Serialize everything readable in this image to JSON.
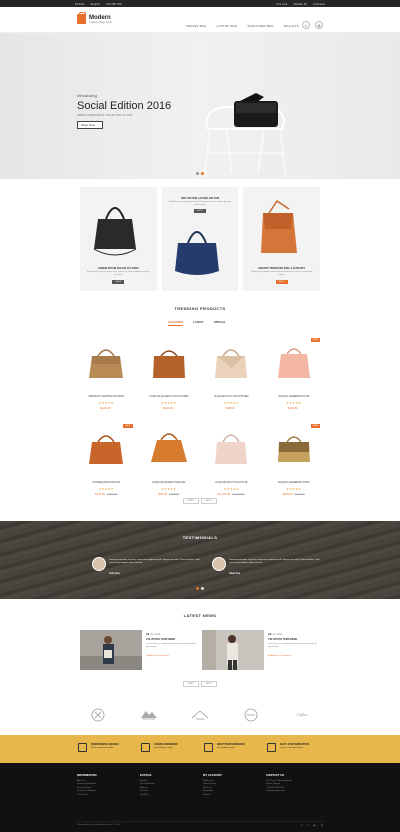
{
  "topbar": {
    "currency": "$ Dollar",
    "language": "English",
    "phone": "123 456 789",
    "account": "Your Link",
    "wishlist": "Wishlist (0)",
    "checkout": "Checkout"
  },
  "header": {
    "logo_title": "Modern",
    "logo_sub": "Creative Bags Shop",
    "nav": [
      "TRAVEL BAG",
      "LAPTOP BAG",
      "SHOULDER BAG",
      "WALLETS"
    ],
    "accent": "#e8702a"
  },
  "hero": {
    "intro": "Introducing",
    "title": "Social Edition 2016",
    "subtitle": "SIMPLE URBAN BAGS COLLECTION OF 2016",
    "button": "Shop Now"
  },
  "banners": [
    {
      "title": "LOREM IPSUM DOLOR SIT AMET",
      "desc": "Nunc efficitur, ultricies ipsum risus, finibus est, tortor vestibulum nisl mi, nec nunc.",
      "button": "SHOP"
    },
    {
      "title": "SED DICTUM LACINIA DICTUM",
      "desc": "Vestibulum ante ipsum primis in faucibus orci luctus et ultrices posuere cubilia curae.",
      "button": "SHOP"
    },
    {
      "title": "MAURIS TINCIDUNT NISL A SUSCIPIT",
      "desc": "Pellentesque habitant morbi tristique senectus et netus et malesuada fames.",
      "button": "SHOP"
    }
  ],
  "trending": {
    "title": "TRENDING PRODUCTS",
    "tabs": [
      "FEATURED",
      "LATEST",
      "SPECIAL"
    ],
    "pager": [
      "PREV",
      "NEXT"
    ]
  },
  "products": [
    {
      "name": "ABSTRACT LEATHER SATCHEL",
      "stars": "★★★★★",
      "price": "$146.00",
      "old": ""
    },
    {
      "name": "ALIQUAM QUAERAT VOLUPTATEM",
      "stars": "★★★★★",
      "price": "$122.00",
      "old": ""
    },
    {
      "name": "ALIQUAM QUAT VOLUPTATEM",
      "stars": "★★★★★",
      "price": "$98.00",
      "old": ""
    },
    {
      "name": "ALIQUET LEABERIAN FUSE",
      "stars": "★★★★★",
      "price": "$122.00",
      "old": "",
      "sale": "SALE"
    },
    {
      "name": "CONSEQUATUR DOLOR",
      "stars": "★★★★★",
      "price": "$134.00",
      "old": "$172.00",
      "sale": "SALE"
    },
    {
      "name": "ALIQUAM QUAERAT MOLLER",
      "stars": "★★★★★",
      "price": "$90.00",
      "old": "$128.00"
    },
    {
      "name": "ALIQUAM QUAT VOLUPTATE",
      "stars": "★★★★★",
      "price": "$1,122.00",
      "old": "$1,140.00"
    },
    {
      "name": "ALIQUET LEABERIAN VORO",
      "stars": "★★★★★",
      "price": "$110.00",
      "old": "$122.00",
      "sale": "SALE"
    }
  ],
  "testimonials": {
    "title": "TESTIMONIALS",
    "items": [
      {
        "text": "Lorem ipsum dolor sit amet, consectetur adipiscing elit. Integer nec odio. Praesent libero. Sed cursus ante dapibus diam sed nisi.",
        "author": "John Doe"
      },
      {
        "text": "Lorem ipsum dolor sit amet, consectetur adipiscing elit. Integer nec odio. Praesent libero. Sed cursus ante dapibus diam sed nisi.",
        "author": "Aliqu Doe"
      }
    ]
  },
  "news": {
    "title": "LATEST NEWS",
    "pager": [
      "PREV",
      "NEXT"
    ],
    "items": [
      {
        "day": "12",
        "month": "Jun 2016",
        "head": "VOLUPTATE TEMP DEMO",
        "desc": "Lorem ipsum is simply dummy text of the printing and typesetting.",
        "meta": "By Admin  ● 0 Comments"
      },
      {
        "day": "12",
        "month": "Jun 2016",
        "head": "VOLUPTATE TEMP DEMO",
        "desc": "Lorem ipsum is simply dummy text of the printing and typesetting.",
        "meta": "By Admin  ● 0 Comments"
      }
    ]
  },
  "brands": [
    "MOUNTAIN",
    "TRAVEL",
    "BRAND",
    "BRAND",
    "Coffee"
  ],
  "features": [
    {
      "title": "RESPONSIVE DESIGN",
      "desc": "100% responsive theme"
    },
    {
      "title": "CROSS BROWSER",
      "desc": "good design is valid"
    },
    {
      "title": "BEST PERFORMANCE",
      "desc": "fast loading images"
    },
    {
      "title": "EASY CUSTOMIZATION",
      "desc": "easy to customize theme"
    }
  ],
  "footer": {
    "cols": [
      {
        "head": "INFORMATION",
        "items": [
          "About Us",
          "Delivery Information",
          "Privacy Policy",
          "Terms & Conditions",
          "Contact Us"
        ]
      },
      {
        "head": "EXTRAS",
        "items": [
          "Brands",
          "Gift Certificates",
          "Affiliate",
          "Specials",
          "Site Map"
        ]
      },
      {
        "head": "MY ACCOUNT",
        "items": [
          "My Account",
          "Order History",
          "Wish List",
          "Newsletter",
          "Returns"
        ]
      },
      {
        "head": "CONTACT US",
        "items": [
          "13, Church Road, Ajegunle",
          "Lagos, Nigeria",
          "+234 800 000 000",
          "info@example.com"
        ]
      }
    ],
    "copyright": "Powered By OpenCart Modern Store © 2016",
    "social": [
      "f",
      "t",
      "g+",
      "in"
    ]
  }
}
